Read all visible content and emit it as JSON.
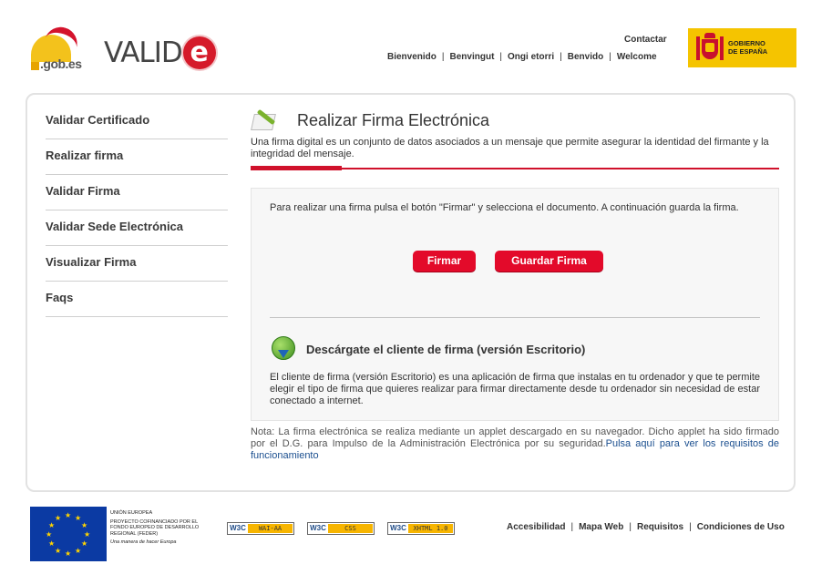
{
  "header": {
    "gob_logo_text": ".gob.es",
    "valide_logo_word": "VALID",
    "valide_logo_letter": "e",
    "contactar": "Contactar",
    "languages": [
      "Bienvenido",
      "Benvingut",
      "Ongi etorri",
      "Benvido",
      "Welcome"
    ],
    "gobierno_line1": "GOBIERNO",
    "gobierno_line2": "DE ESPAÑA"
  },
  "sidebar": {
    "items": [
      {
        "label": "Validar Certificado"
      },
      {
        "label": "Realizar firma"
      },
      {
        "label": "Validar Firma"
      },
      {
        "label": "Validar Sede Electrónica"
      },
      {
        "label": "Visualizar Firma"
      },
      {
        "label": "Faqs"
      }
    ]
  },
  "main": {
    "title": "Realizar Firma Electrónica",
    "intro": "Una firma digital es un conjunto de datos asociados a un mensaje que permite asegurar la identidad del firmante y la integridad del mensaje.",
    "instructions": "Para realizar una firma pulsa el botón \"Firmar\" y selecciona el documento. A continuación guarda la firma.",
    "firmar_button": "Firmar",
    "guardar_button": "Guardar Firma",
    "download_title": "Descárgate el cliente de firma (versión Escritorio)",
    "download_text": "El cliente de firma (versión Escritorio) es una aplicación de firma que instalas en tu ordenador y que te permite elegir el tipo de firma que quieres realizar para firmar directamente desde tu ordenador sin necesidad de estar conectado a internet.",
    "note_text": "Nota: La firma electrónica se realiza mediante un applet descargado en su navegador. Dicho applet ha sido firmado por el D.G. para Impulso de la Administración Electrónica por su seguridad.",
    "note_link": "Pulsa aquí para ver los requisitos de funcionamiento"
  },
  "footer": {
    "eu_line1": "UNIÓN EUROPEA",
    "eu_line2": "PROYECTO COFINANCIADO POR EL FONDO EUROPEO DE DESARROLLO REGIONAL (FEDER)",
    "eu_line3": "Una manera de hacer Europa",
    "badges": [
      {
        "logo": "W3C",
        "text": "WAI-AA"
      },
      {
        "logo": "W3C",
        "text": "CSS"
      },
      {
        "logo": "W3C",
        "text": "XHTML 1.0"
      }
    ],
    "links": [
      "Accesibilidad",
      "Mapa Web",
      "Requisitos",
      "Condiciones de Uso"
    ]
  },
  "colors": {
    "accent_red": "#e30a2a",
    "gobierno_yellow": "#f5c400",
    "eu_blue": "#0b3aa3",
    "link_blue": "#1b4f8f"
  },
  "icons": {
    "title_icon": "signature-pen-icon",
    "download_icon": "globe-download-icon"
  }
}
